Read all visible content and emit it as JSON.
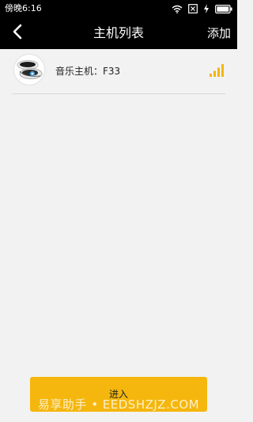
{
  "status_bar": {
    "time": "傍晚6:16",
    "icons": [
      "wifi-icon",
      "sim-x-icon",
      "charging-icon",
      "battery-icon"
    ]
  },
  "header": {
    "title": "主机列表",
    "add_label": "添加",
    "back_icon": "chevron-left-icon"
  },
  "devices": [
    {
      "name": "音乐主机：F33",
      "icon": "speaker-device-icon",
      "signal_icon": "signal-strength-icon"
    }
  ],
  "footer": {
    "enter_label": "进入",
    "watermark": "易享助手 • EEDSHZJZ.COM"
  },
  "colors": {
    "header_bg": "#000000",
    "page_bg": "#f2f2f2",
    "accent": "#f5b70d",
    "signal": "#f2b713"
  }
}
